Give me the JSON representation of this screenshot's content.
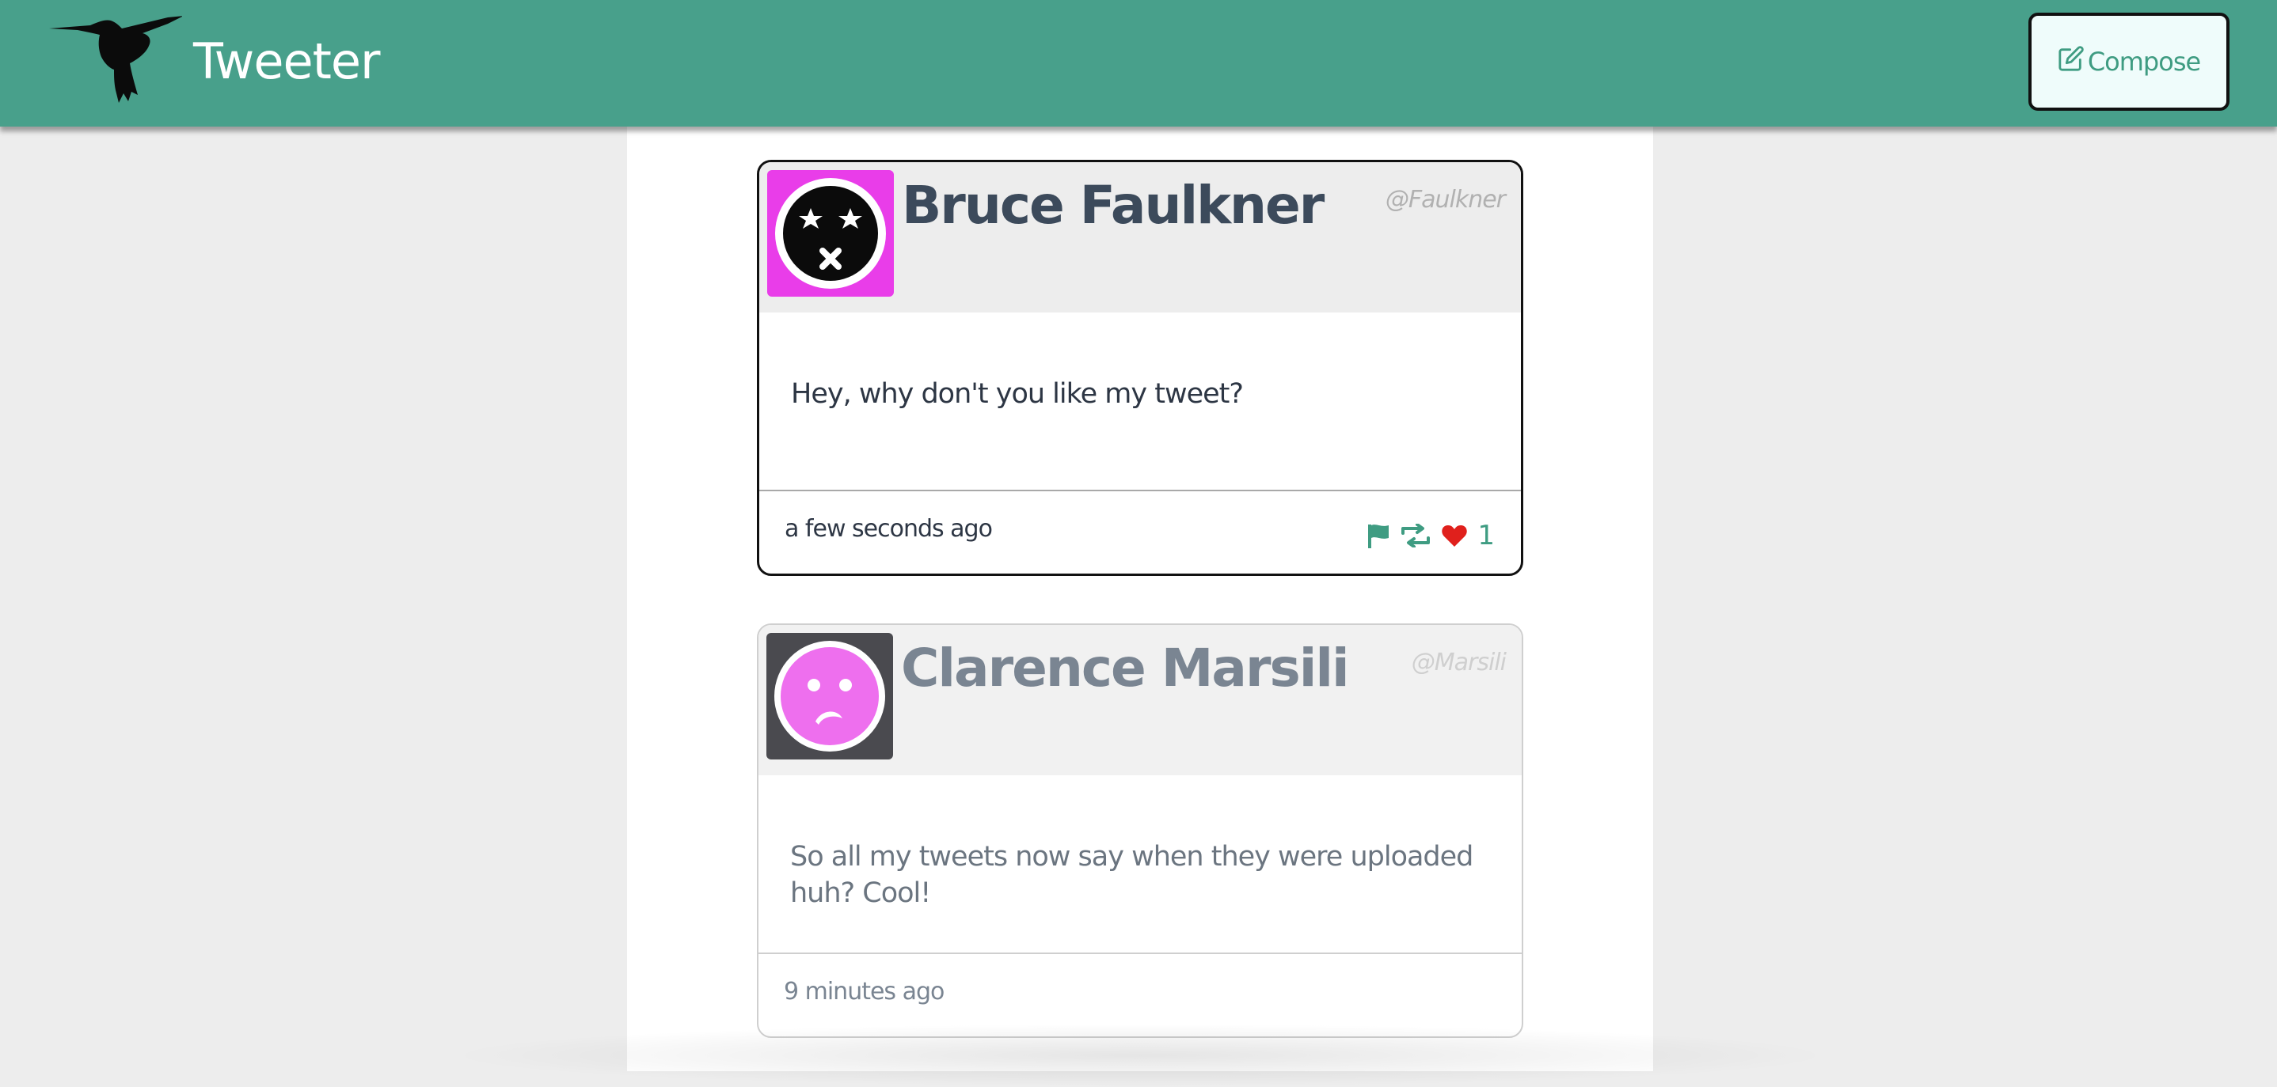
{
  "nav": {
    "brand": "Tweeter",
    "compose_label": "Compose",
    "logo_icon": "hummingbird-icon",
    "compose_icon": "edit-icon"
  },
  "colors": {
    "nav_bg": "#48a08b",
    "accent": "#3f9c82",
    "like": "#e0201c"
  },
  "tweets": [
    {
      "name": "Bruce Faulkner",
      "handle": "@Faulkner",
      "text": "Hey, why don't you like my tweet?",
      "time": "a few seconds ago",
      "likes": "1",
      "avatar_icon": "dizzy-face-icon",
      "avatar_bg": "#e93de9",
      "actions": [
        "flag-icon",
        "retweet-icon",
        "heart-icon"
      ]
    },
    {
      "name": "Clarence Marsili",
      "handle": "@Marsili",
      "text": "So all my tweets now say when they were uploaded huh? Cool!",
      "time": "9 minutes ago",
      "avatar_icon": "frown-face-icon",
      "avatar_bg": "#4a4a4f"
    }
  ]
}
